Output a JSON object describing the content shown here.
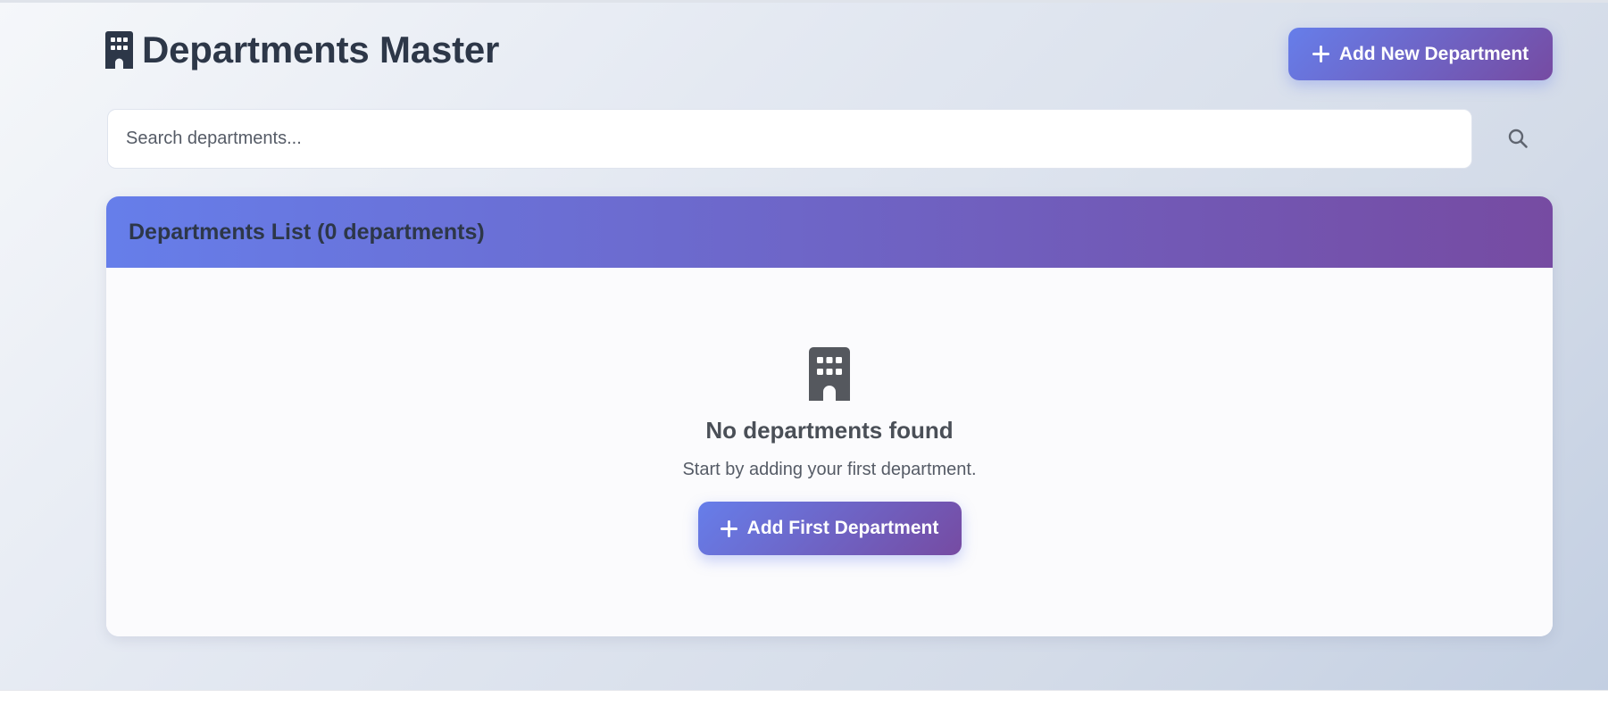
{
  "header": {
    "title": "Departments Master",
    "title_icon": "building-icon",
    "add_button_label": "Add New Department",
    "add_button_icon": "plus-icon"
  },
  "search": {
    "placeholder": "Search departments...",
    "value": "",
    "icon": "search-icon"
  },
  "list": {
    "title": "Departments List (0 departments)",
    "count": 0,
    "empty_state": {
      "icon": "building-icon",
      "title": "No departments found",
      "subtitle": "Start by adding your first department.",
      "button_label": "Add First Department",
      "button_icon": "plus-icon"
    }
  },
  "colors": {
    "accent_start": "#667eea",
    "accent_end": "#764ba2",
    "heading_text": "#2d3748",
    "muted_text": "#555b66"
  }
}
